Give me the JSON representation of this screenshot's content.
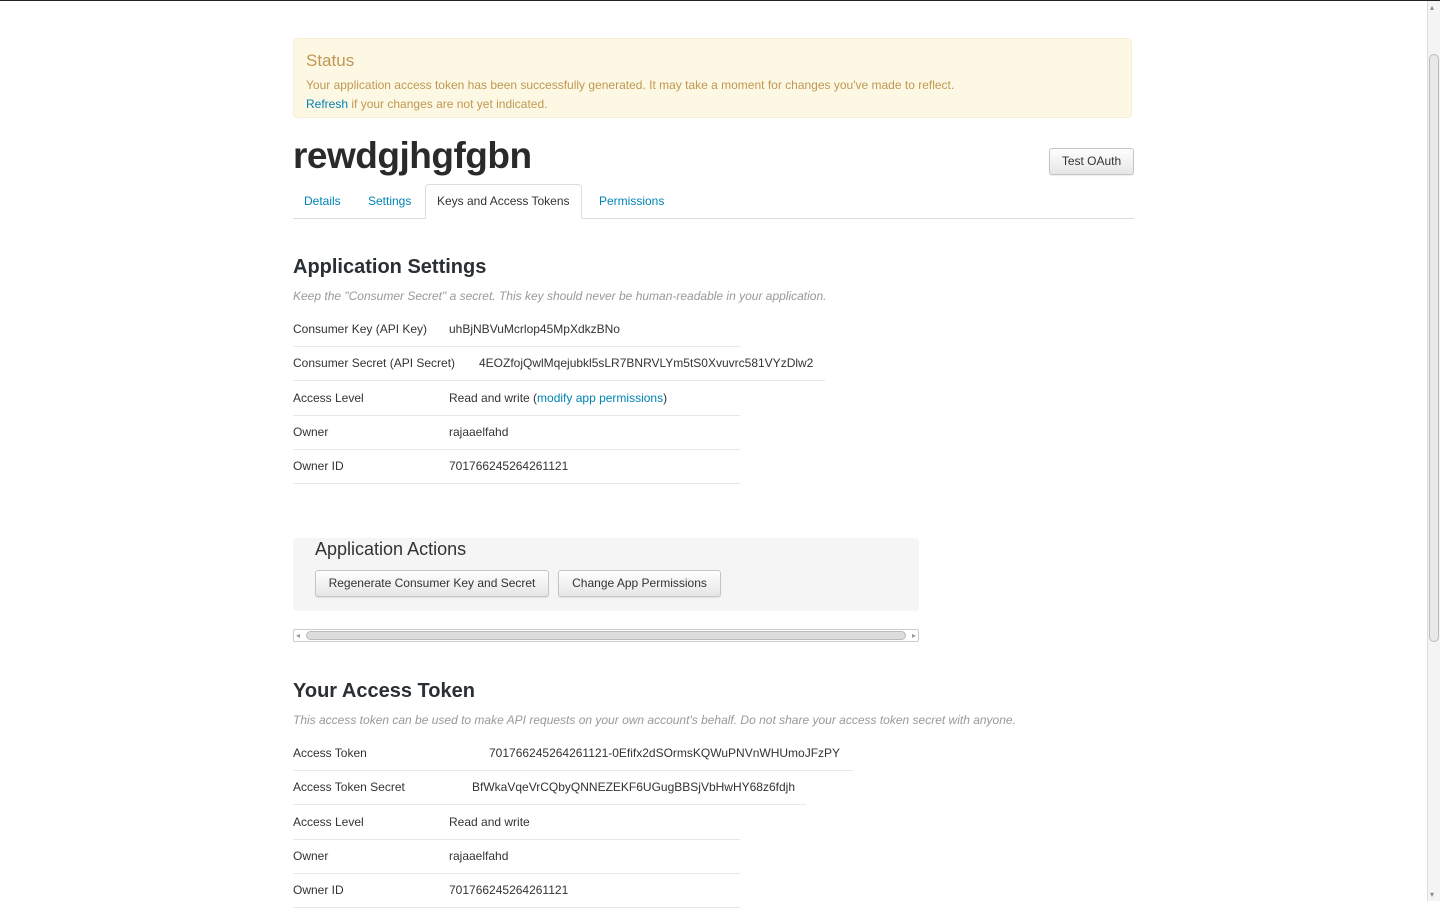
{
  "status": {
    "title": "Status",
    "message": "Your application access token has been successfully generated. It may take a moment for changes you've made to reflect.",
    "refresh_link": "Refresh",
    "refresh_suffix": " if your changes are not yet indicated."
  },
  "app": {
    "name": "rewdgjhgfgbn",
    "test_oauth_label": "Test OAuth"
  },
  "tabs": [
    {
      "label": "Details"
    },
    {
      "label": "Settings"
    },
    {
      "label": "Keys and Access Tokens"
    },
    {
      "label": "Permissions"
    }
  ],
  "app_settings": {
    "heading": "Application Settings",
    "note": "Keep the \"Consumer Secret\" a secret. This key should never be human-readable in your application.",
    "consumer_key_label": "Consumer Key (API Key)",
    "consumer_key": "uhBjNBVuMcrlop45MpXdkzBNo",
    "consumer_secret_label": "Consumer Secret (API Secret)",
    "consumer_secret": "4EOZfojQwlMqejubkl5sLR7BNRVLYm5tS0Xvuvrc581VYzDlw2",
    "access_level_label": "Access Level",
    "access_level": "Read and write (",
    "modify_link": "modify app permissions",
    "access_level_close": ")",
    "owner_label": "Owner",
    "owner": "rajaaelfahd",
    "owner_id_label": "Owner ID",
    "owner_id": "701766245264261121"
  },
  "actions": {
    "heading": "Application Actions",
    "regenerate_label": "Regenerate Consumer Key and Secret",
    "change_label": "Change App Permissions"
  },
  "token": {
    "heading": "Your Access Token",
    "note": "This access token can be used to make API requests on your own account's behalf. Do not share your access token secret with anyone.",
    "access_token_label": "Access Token",
    "access_token": "701766245264261121-0Efifx2dSOrmsKQWuPNVnWHUmoJFzPY",
    "access_token_secret_label": "Access Token Secret",
    "access_token_secret": "BfWkaVqeVrCQbyQNNEZEKF6UGugBBSjVbHwHY68z6fdjh",
    "access_level_label": "Access Level",
    "access_level": "Read and write",
    "owner_label": "Owner",
    "owner": "rajaaelfahd",
    "owner_id_label": "Owner ID",
    "owner_id": "701766245264261121"
  },
  "colors": {
    "link": "#0084b4",
    "alert_bg": "#fcf8e3",
    "alert_text": "#c09853"
  }
}
